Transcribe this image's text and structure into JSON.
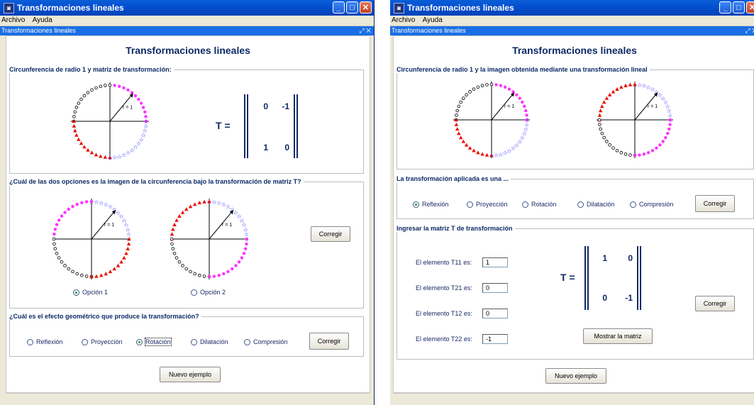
{
  "window1": {
    "title": "Transformaciones lineales",
    "menu": [
      "Archivo",
      "Ayuda"
    ],
    "iframe_title": "Transformaciones lineales",
    "iframe_controls": "⤢ ✕",
    "heading": "Transformaciones lineales",
    "panel1": {
      "legend": "Circunferencia de radio 1 y matriz de transformación:",
      "radius_label": "r = 1",
      "matrix": {
        "label": "T =",
        "cells": [
          "0",
          "-1",
          "1",
          "0"
        ]
      }
    },
    "panel2": {
      "legend": "¿Cuál de las dos opciones es la imagen de la circunferencia bajo la transformación de matriz T?",
      "radius_label": "r = 1",
      "option1": "Opción 1",
      "option2": "Opción 2",
      "selected": "Opción 1",
      "button": "Corregir"
    },
    "panel3": {
      "legend": "¿Cuál es el efecto geométrico que produce la transformación?",
      "options": [
        "Reflexión",
        "Proyección",
        "Rotación",
        "Dilatación",
        "Compresión"
      ],
      "selected": "Rotación",
      "button": "Corregir"
    },
    "new_example": "Nuevo ejemplo"
  },
  "window2": {
    "title": "Transformaciones lineales",
    "menu": [
      "Archivo",
      "Ayuda"
    ],
    "iframe_title": "Transformaciones lineales",
    "iframe_controls": "⤢ ✕",
    "heading": "Transformaciones lineales",
    "panel1": {
      "legend": "Circunferencia de radio 1 y la imagen obtenida mediante una transformación lineal",
      "radius_label": "r = 1"
    },
    "panel2": {
      "legend": "La transformación aplicada es una ...",
      "options": [
        "Reflexión",
        "Proyección",
        "Rotación",
        "Dilatación",
        "Compresión"
      ],
      "selected": "Reflexión",
      "button": "Corregir"
    },
    "panel3": {
      "legend": "Ingresar la matriz T de transformación",
      "fields": [
        {
          "label": "El elemento T11 es:",
          "value": "1"
        },
        {
          "label": "El elemento T21 es:",
          "value": "0"
        },
        {
          "label": "El elemento T12 es:",
          "value": "0"
        },
        {
          "label": "El elemento T22 es:",
          "value": "-1"
        }
      ],
      "matrix": {
        "label": "T =",
        "cells": [
          "1",
          "0",
          "0",
          "-1"
        ]
      },
      "show_button": "Mostrar la matriz",
      "button": "Corregir"
    },
    "new_example": "Nuevo ejemplo"
  },
  "colors": {
    "title_blue": "#0c2a66",
    "magenta": "#ff33ff",
    "red": "#e8140a",
    "blue": "#1a1aff",
    "accent_window": "#0450d0"
  },
  "circle_quadrants": {
    "original": {
      "quadrant_1": "magenta-dots",
      "quadrant_2": "black-circles",
      "quadrant_3": "red-triangles",
      "quadrant_4": "blue-stars"
    },
    "option1": {
      "quadrant_1": "blue-stars",
      "quadrant_2": "magenta-dots",
      "quadrant_3": "black-circles",
      "quadrant_4": "red-triangles"
    },
    "option2": {
      "quadrant_1": "blue-stars",
      "quadrant_2": "red-triangles",
      "quadrant_3": "black-circles",
      "quadrant_4": "magenta-dots"
    },
    "image_reflection": {
      "quadrant_1": "blue-stars",
      "quadrant_2": "red-triangles",
      "quadrant_3": "black-circles",
      "quadrant_4": "magenta-dots"
    }
  }
}
